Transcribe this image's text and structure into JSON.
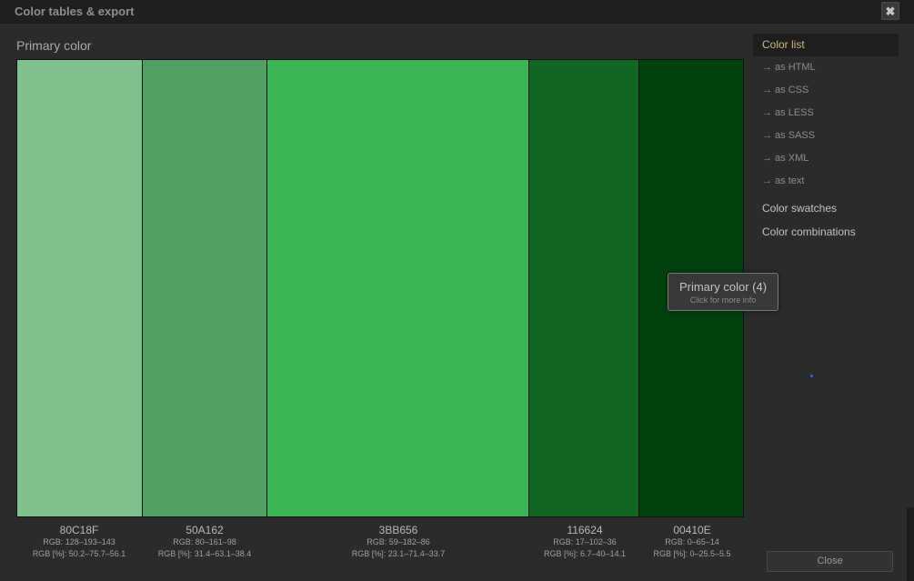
{
  "window": {
    "title": "Color tables & export",
    "close_glyph": "✖"
  },
  "section_title": "Primary color",
  "swatches": [
    {
      "color": "#80C18F",
      "hex": "80C18F",
      "rgb": "RGB: 128–193–143",
      "rgb_pct": "RGB [%]: 50.2–75.7–56.1"
    },
    {
      "color": "#50A162",
      "hex": "50A162",
      "rgb": "RGB: 80–161–98",
      "rgb_pct": "RGB [%]: 31.4–63.1–38.4"
    },
    {
      "color": "#3BB656",
      "hex": "3BB656",
      "rgb": "RGB: 59–182–86",
      "rgb_pct": "RGB [%]: 23.1–71.4–33.7"
    },
    {
      "color": "#116624",
      "hex": "116624",
      "rgb": "RGB: 17–102–36",
      "rgb_pct": "RGB [%]: 6.7–40–14.1"
    },
    {
      "color": "#00410E",
      "hex": "00410E",
      "rgb": "RGB: 0–65–14",
      "rgb_pct": "RGB [%]: 0–25.5–5.5"
    }
  ],
  "tooltip": {
    "title": "Primary color (4)",
    "subtitle": "Click for more info"
  },
  "sidebar": {
    "active": "Color list",
    "sub_items": [
      "→ as HTML",
      "→ as CSS",
      "→ as LESS",
      "→ as SASS",
      "→ as XML",
      "→ as text"
    ],
    "items": [
      "Color swatches",
      "Color combinations"
    ]
  },
  "close_button": "Close"
}
